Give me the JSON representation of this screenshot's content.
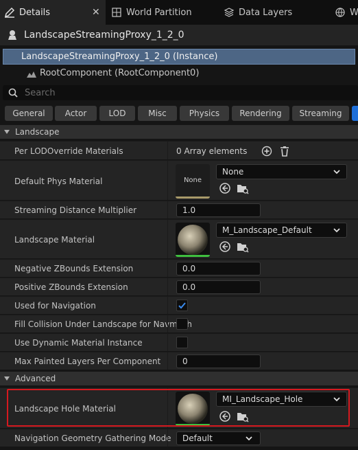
{
  "tabs": [
    {
      "label": "Details",
      "close": "✕"
    },
    {
      "label": "World Partition"
    },
    {
      "label": "Data Layers"
    },
    {
      "label": "W"
    }
  ],
  "actor": {
    "name": "LandscapeStreamingProxy_1_2_0"
  },
  "tree": {
    "instance": "LandscapeStreamingProxy_1_2_0 (Instance)",
    "root": "RootComponent (RootComponent0)"
  },
  "search": {
    "placeholder": "Search"
  },
  "categories": [
    "General",
    "Actor",
    "LOD",
    "Misc",
    "Physics",
    "Rendering",
    "Streaming"
  ],
  "sections": {
    "landscape": "Landscape",
    "advanced": "Advanced"
  },
  "properties": {
    "per_lod": {
      "label": "Per LODOverride Materials",
      "value": "0 Array elements"
    },
    "phys_material": {
      "label": "Default Phys Material",
      "thumb": "None",
      "value": "None"
    },
    "streaming_distance": {
      "label": "Streaming Distance Multiplier",
      "value": "1.0"
    },
    "landscape_material": {
      "label": "Landscape Material",
      "value": "M_Landscape_Default"
    },
    "neg_zbounds": {
      "label": "Negative ZBounds Extension",
      "value": "0.0"
    },
    "pos_zbounds": {
      "label": "Positive ZBounds Extension",
      "value": "0.0"
    },
    "used_for_nav": {
      "label": "Used for Navigation",
      "checked": true
    },
    "fill_collision": {
      "label": "Fill Collision Under Landscape for Navmesh",
      "checked": false
    },
    "dynamic_material": {
      "label": "Use Dynamic Material Instance",
      "checked": false
    },
    "max_painted": {
      "label": "Max Painted Layers Per Component",
      "value": "0"
    },
    "hole_material": {
      "label": "Landscape Hole Material",
      "value": "MI_Landscape_Hole"
    },
    "nav_gathering": {
      "label": "Navigation Geometry Gathering Mode",
      "value": "Default"
    }
  },
  "colors": {
    "accent": "#1f6fd8",
    "selection": "#4d6685",
    "highlight": "#d6191f",
    "asset_valid": "#3fbf3f"
  }
}
